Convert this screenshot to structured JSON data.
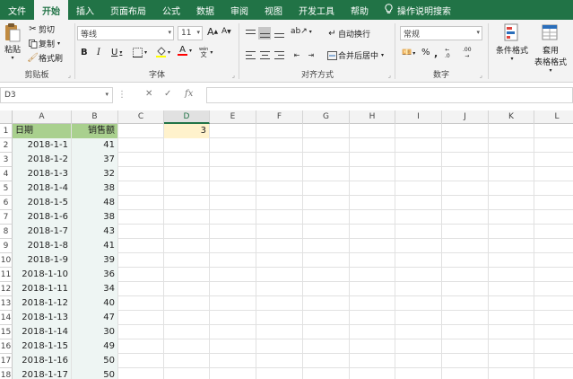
{
  "tabs": [
    "文件",
    "开始",
    "插入",
    "页面布局",
    "公式",
    "数据",
    "审阅",
    "视图",
    "开发工具",
    "帮助",
    "操作说明搜索"
  ],
  "ribbon": {
    "clipboard": {
      "paste": "粘贴",
      "cut": "剪切",
      "copy": "复制",
      "format_painter": "格式刷",
      "label": "剪贴板"
    },
    "font": {
      "name": "等线",
      "size": "11",
      "grow": "A",
      "shrink": "A",
      "bold": "B",
      "italic": "I",
      "underline": "U",
      "font_color_glyph": "A",
      "label": "字体"
    },
    "alignment": {
      "wrap": "自动换行",
      "merge": "合并后居中",
      "label": "对齐方式"
    },
    "number": {
      "format": "常规",
      "label": "数字",
      "decrease_decimal": ".00",
      "increase_decimal": ".0"
    },
    "styles": {
      "conditional": "条件格式",
      "table1": "套用",
      "table2": "表格格式"
    }
  },
  "formula_bar": {
    "name_box": "D3",
    "dots": "⋮",
    "cancel": "✕",
    "enter": "✓",
    "fx": "fx",
    "value": ""
  },
  "grid": {
    "columns": [
      "A",
      "B",
      "C",
      "D",
      "E",
      "F",
      "G",
      "H",
      "I",
      "J",
      "K",
      "L"
    ],
    "selected_column": "D",
    "rows": [
      "1",
      "2",
      "3",
      "4",
      "5",
      "6",
      "7",
      "8",
      "9",
      "10",
      "11",
      "12",
      "13",
      "14",
      "15",
      "16",
      "17",
      "18"
    ],
    "header": {
      "a": "日期",
      "b": "销售额"
    },
    "data": [
      {
        "date": "2018-1-1",
        "sales": "41"
      },
      {
        "date": "2018-1-2",
        "sales": "37"
      },
      {
        "date": "2018-1-3",
        "sales": "32"
      },
      {
        "date": "2018-1-4",
        "sales": "38"
      },
      {
        "date": "2018-1-5",
        "sales": "48"
      },
      {
        "date": "2018-1-6",
        "sales": "38"
      },
      {
        "date": "2018-1-7",
        "sales": "43"
      },
      {
        "date": "2018-1-8",
        "sales": "41"
      },
      {
        "date": "2018-1-9",
        "sales": "39"
      },
      {
        "date": "2018-1-10",
        "sales": "36"
      },
      {
        "date": "2018-1-11",
        "sales": "34"
      },
      {
        "date": "2018-1-12",
        "sales": "40"
      },
      {
        "date": "2018-1-13",
        "sales": "47"
      },
      {
        "date": "2018-1-14",
        "sales": "30"
      },
      {
        "date": "2018-1-15",
        "sales": "49"
      },
      {
        "date": "2018-1-16",
        "sales": "50"
      },
      {
        "date": "2018-1-17",
        "sales": "50"
      }
    ],
    "d1": "3"
  },
  "colors": {
    "excel_green": "#217346",
    "header_fill": "#a9d08e",
    "highlight_fill": "#fff2cc"
  }
}
